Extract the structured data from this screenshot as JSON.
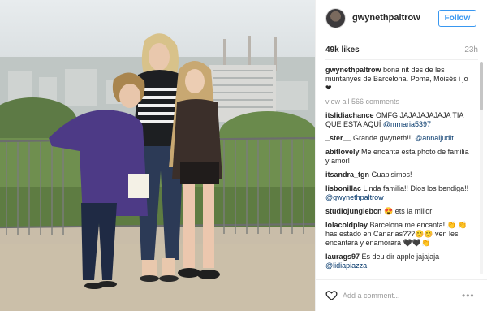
{
  "post": {
    "username": "gwynethpaltrow",
    "follow_label": "Follow",
    "likes": "49k likes",
    "time_ago": "23h",
    "caption": {
      "user": "gwynethpaltrow",
      "text": "bona nit des de les muntanyes de Barcelona. Poma, Moisès i jo ❤"
    },
    "view_all": "view all 566 comments",
    "comments": [
      {
        "user": "itslidiachance",
        "text": "OMFG JAJAJAJAJAJA TIA QUE ESTA AQUÍ",
        "mention": "@mmaria5397"
      },
      {
        "user": "_ster__",
        "text": "Grande gwyneth!!!",
        "mention": "@annaijudit"
      },
      {
        "user": "abitlovely",
        "text": "Me encanta esta photo de familia y amor!",
        "mention": ""
      },
      {
        "user": "itsandra_tgn",
        "text": "Guapisimos!",
        "mention": ""
      },
      {
        "user": "lisbonillac",
        "text": "Linda familia!! Dios los bendiga!!",
        "mention": "@gwynethpaltrow"
      },
      {
        "user": "studiojunglebcn",
        "text": "😍 ets la millor!",
        "mention": ""
      },
      {
        "user": "lolacoldplay",
        "text": "Barcelona me encanta!!👏 👏 has estado en Canarias???😊😊 ven les encantará y enamorara 🖤🖤👏",
        "mention": ""
      },
      {
        "user": "laurags97",
        "text": "Es deu dir apple jajajaja",
        "mention": "@lidiapiazza"
      }
    ],
    "add_comment_placeholder": "Add a comment...",
    "more_label": "•••"
  },
  "icons": {
    "like": "heart-icon",
    "more": "more-options-icon"
  },
  "colors": {
    "follow_blue": "#3897f0",
    "mention": "#003569",
    "muted": "#999999"
  }
}
